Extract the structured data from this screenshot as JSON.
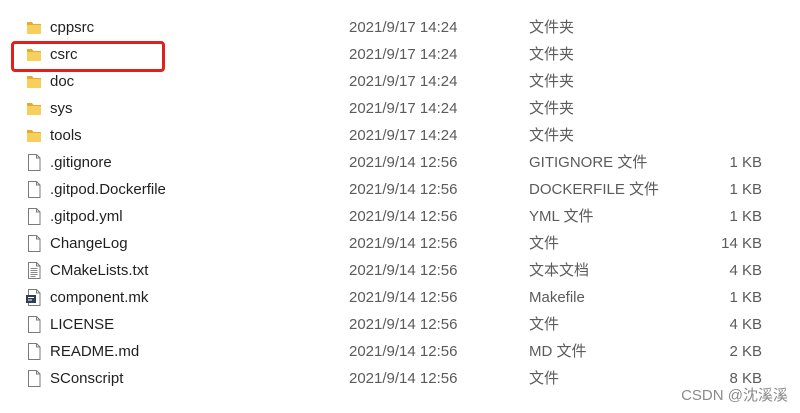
{
  "files": [
    {
      "name": "cppsrc",
      "date": "2021/9/17 14:24",
      "type": "文件夹",
      "size": "",
      "icon": "folder-icon"
    },
    {
      "name": "csrc",
      "date": "2021/9/17 14:24",
      "type": "文件夹",
      "size": "",
      "icon": "folder-icon"
    },
    {
      "name": "doc",
      "date": "2021/9/17 14:24",
      "type": "文件夹",
      "size": "",
      "icon": "folder-icon"
    },
    {
      "name": "sys",
      "date": "2021/9/17 14:24",
      "type": "文件夹",
      "size": "",
      "icon": "folder-icon"
    },
    {
      "name": "tools",
      "date": "2021/9/17 14:24",
      "type": "文件夹",
      "size": "",
      "icon": "folder-icon"
    },
    {
      "name": ".gitignore",
      "date": "2021/9/14 12:56",
      "type": "GITIGNORE 文件",
      "size": "1 KB",
      "icon": "file-icon"
    },
    {
      "name": ".gitpod.Dockerfile",
      "date": "2021/9/14 12:56",
      "type": "DOCKERFILE 文件",
      "size": "1 KB",
      "icon": "file-icon"
    },
    {
      "name": ".gitpod.yml",
      "date": "2021/9/14 12:56",
      "type": "YML 文件",
      "size": "1 KB",
      "icon": "file-icon"
    },
    {
      "name": "ChangeLog",
      "date": "2021/9/14 12:56",
      "type": "文件",
      "size": "14 KB",
      "icon": "file-icon"
    },
    {
      "name": "CMakeLists.txt",
      "date": "2021/9/14 12:56",
      "type": "文本文档",
      "size": "4 KB",
      "icon": "text-file-icon"
    },
    {
      "name": "component.mk",
      "date": "2021/9/14 12:56",
      "type": "Makefile",
      "size": "1 KB",
      "icon": "makefile-icon"
    },
    {
      "name": "LICENSE",
      "date": "2021/9/14 12:56",
      "type": "文件",
      "size": "4 KB",
      "icon": "file-icon"
    },
    {
      "name": "README.md",
      "date": "2021/9/14 12:56",
      "type": "MD 文件",
      "size": "2 KB",
      "icon": "file-icon"
    },
    {
      "name": "SConscript",
      "date": "2021/9/14 12:56",
      "type": "文件",
      "size": "8 KB",
      "icon": "file-icon"
    }
  ],
  "highlight_color": "#e0201c",
  "folder_color": "#f2c04a",
  "watermark": "CSDN @沈溪溪"
}
